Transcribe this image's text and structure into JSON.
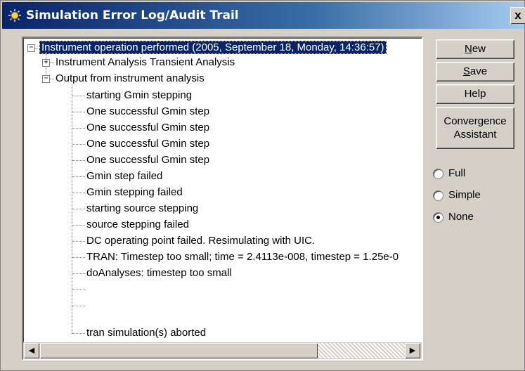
{
  "window": {
    "title": "Simulation Error Log/Audit Trail",
    "close_label": "x"
  },
  "tree": {
    "root": "Instrument operation performed  (2005, September 18, Monday, 14:36:57)",
    "child1": "Instrument Analysis Transient Analysis",
    "child2": "Output from instrument analysis",
    "leaves": [
      "starting Gmin stepping",
      "One successful Gmin step",
      "One successful Gmin step",
      "One successful Gmin step",
      "One successful Gmin step",
      "Gmin step failed",
      "Gmin stepping failed",
      "starting source stepping",
      "source stepping failed",
      "DC operating point failed. Resimulating with UIC.",
      "TRAN:  Timestep too small; time = 2.4113e-008, timestep = 1.25e-0",
      "doAnalyses: timestep too small",
      "",
      "",
      "tran simulation(s) aborted"
    ]
  },
  "buttons": {
    "new": "New",
    "save": "Save",
    "help": "Help",
    "convergence_line1": "Convergence",
    "convergence_line2": "Assistant"
  },
  "options": {
    "full": "Full",
    "simple": "Simple",
    "none": "None",
    "selected": "None"
  },
  "scrollbar": {
    "left_arrow": "◀",
    "right_arrow": "▶"
  }
}
